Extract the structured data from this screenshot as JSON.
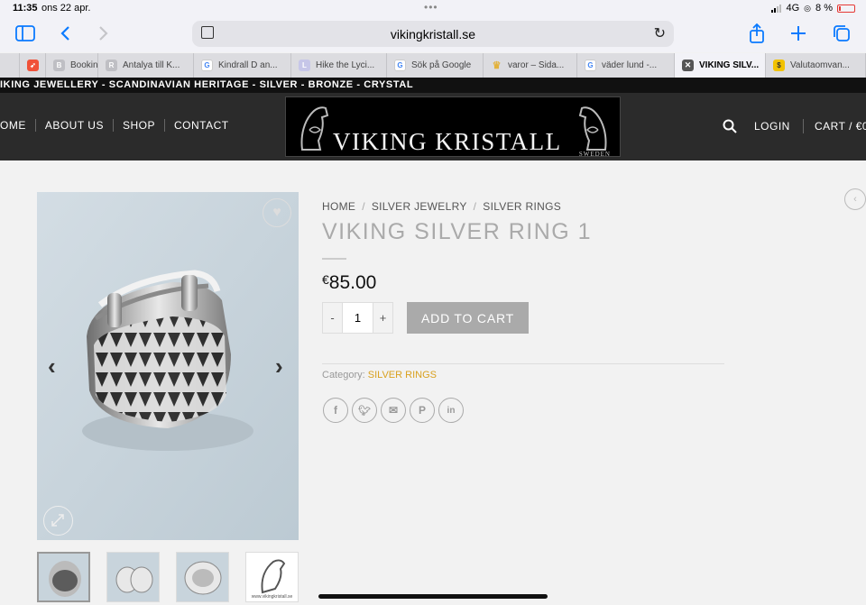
{
  "status": {
    "time": "11:35",
    "date": "ons 22 apr.",
    "network": "4G",
    "battery": "8 %"
  },
  "browser": {
    "url": "vikingkristall.se",
    "tabs": [
      {
        "label": "",
        "icon": "blank-tab",
        "color": "#dcdce0"
      },
      {
        "label": "",
        "icon": "swift-icon",
        "color": "#f05138"
      },
      {
        "label": "Bookin",
        "icon": "B",
        "color": "#bfbfc4"
      },
      {
        "label": "Antalya till K...",
        "icon": "R",
        "color": "#bfbfc4"
      },
      {
        "label": "Kindrall D an...",
        "icon": "G",
        "color": "#4285f4"
      },
      {
        "label": "Hike the Lyci...",
        "icon": "L",
        "color": "#c6c6e8"
      },
      {
        "label": "Sök på Google",
        "icon": "G",
        "color": "#4285f4"
      },
      {
        "label": "varor – Sida...",
        "icon": "crown",
        "color": "#e3b23c"
      },
      {
        "label": "väder lund -...",
        "icon": "G",
        "color": "#4285f4"
      },
      {
        "label": "VIKING SILV...",
        "icon": "x",
        "color": "#555555"
      },
      {
        "label": "Valutaomvan...",
        "icon": "$",
        "color": "#f2c200"
      }
    ]
  },
  "site": {
    "topbar": "IKING JEWELLERY - SCANDINAVIAN HERITAGE - SILVER - BRONZE - CRYSTAL",
    "nav": [
      "OME",
      "ABOUT US",
      "SHOP",
      "CONTACT"
    ],
    "logo_text": "VIKING KRISTALL",
    "logo_sub": "SWEDEN",
    "login": "LOGIN",
    "cart": "CART / €0"
  },
  "product": {
    "breadcrumb": [
      "HOME",
      "SILVER JEWELRY",
      "SILVER RINGS"
    ],
    "title": "VIKING SILVER RING 1",
    "currency": "€",
    "price": "85.00",
    "quantity": "1",
    "qty_minus": "-",
    "qty_plus": "+",
    "add_to_cart": "ADD TO CART",
    "category_label": "Category:",
    "category_value": "SILVER RINGS",
    "thumb_caption": "www.vikingkristall.se",
    "share_icons": [
      "facebook-icon",
      "twitter-icon",
      "email-icon",
      "pinterest-icon",
      "linkedin-icon"
    ]
  },
  "colors": {
    "accent": "#d9a11f",
    "header_bg": "#2b2b2b",
    "button_bg": "#aaaaaa",
    "ios_blue": "#0a7aff"
  }
}
